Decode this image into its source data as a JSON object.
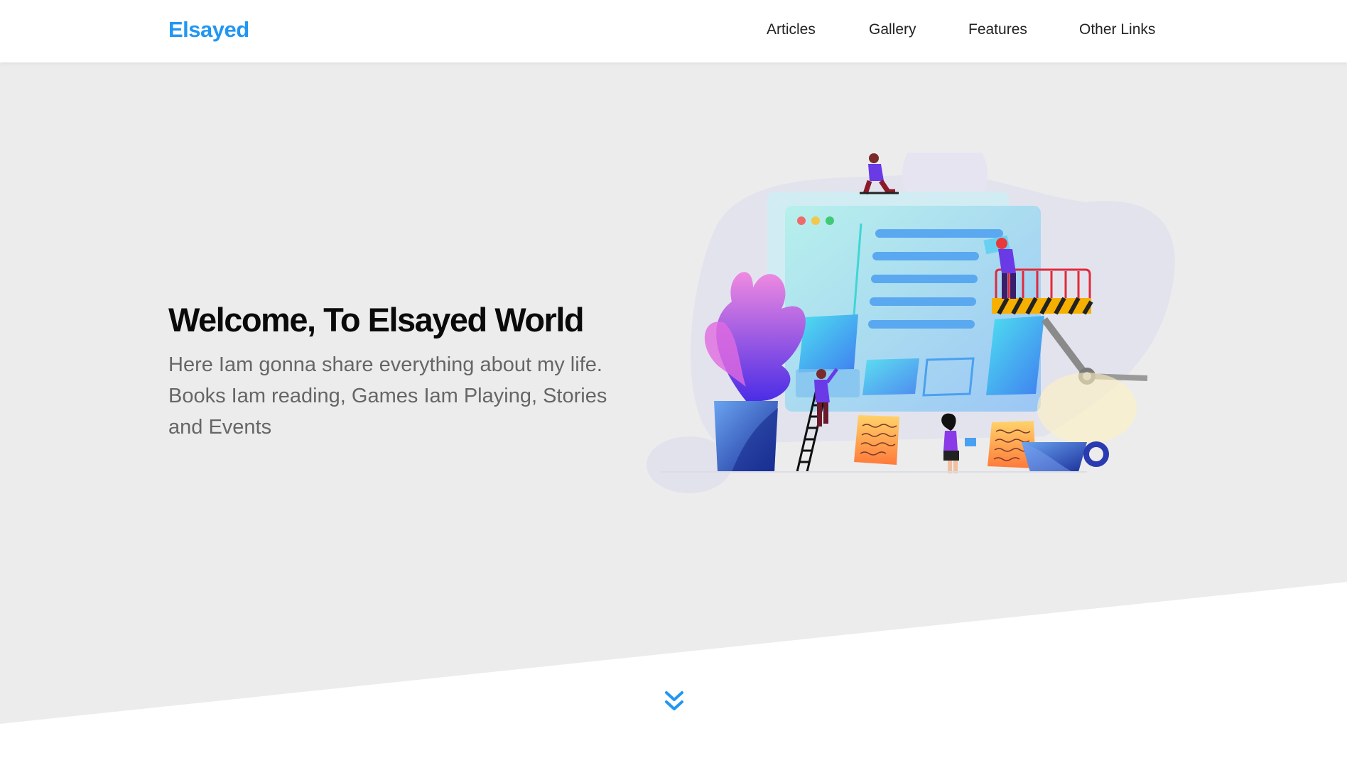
{
  "header": {
    "logo": "Elsayed",
    "nav": [
      "Articles",
      "Gallery",
      "Features",
      "Other Links"
    ]
  },
  "hero": {
    "title": "Welcome, To Elsayed World",
    "description": "Here Iam gonna share everything about my life. Books Iam reading, Games Iam Playing, Stories and Events",
    "illustration": "website-construction-illustration",
    "scroll_icon": "double-chevron-down-icon"
  },
  "colors": {
    "accent": "#2196f3",
    "hero_background": "#ececec",
    "text_dark": "#0a0a0a",
    "text_muted": "#666666"
  }
}
